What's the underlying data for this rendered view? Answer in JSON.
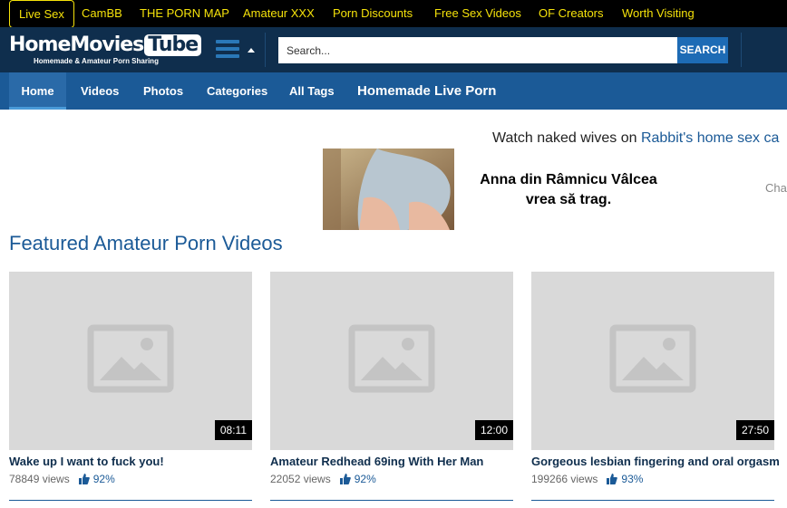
{
  "topbar": {
    "links": [
      {
        "label": "Live Sex"
      },
      {
        "label": "CamBB"
      },
      {
        "label": "THE PORN MAP"
      },
      {
        "label": "Amateur XXX"
      },
      {
        "label": "Porn Discounts"
      },
      {
        "label": "Free Sex Videos"
      },
      {
        "label": "OF Creators"
      },
      {
        "label": "Worth Visiting"
      }
    ],
    "color": "#f5e20a"
  },
  "header": {
    "logo_main": "HomeMovies",
    "logo_tube": "Tube",
    "logo_sub": "Homemade & Amateur Porn Sharing",
    "search_placeholder": "Search...",
    "search_button": "SEARCH",
    "bg_color": "#0f2e4d"
  },
  "nav": {
    "items": [
      {
        "label": "Home"
      },
      {
        "label": "Videos"
      },
      {
        "label": "Photos"
      },
      {
        "label": "Categories"
      },
      {
        "label": "All Tags"
      },
      {
        "label": "Homemade Live Porn"
      }
    ],
    "bg_color": "#1b5a97"
  },
  "promo": {
    "text_before": "Watch naked wives on ",
    "link_text": "Rabbit's home sex ca",
    "ad_title_line1": "Anna din Râmnicu Vâlcea",
    "ad_title_line2": "vrea să trag.",
    "side_text": "Cha"
  },
  "section": {
    "title": "Featured Amateur Porn Videos"
  },
  "videos": [
    {
      "title": "Wake up I want to fuck you!",
      "duration": "08:11",
      "views": "78849 views",
      "rating": "92%"
    },
    {
      "title": "Amateur Redhead 69ing With Her Man",
      "duration": "12:00",
      "views": "22052 views",
      "rating": "92%"
    },
    {
      "title": "Gorgeous lesbian fingering and oral orgasm",
      "duration": "27:50",
      "views": "199266 views",
      "rating": "93%"
    }
  ]
}
